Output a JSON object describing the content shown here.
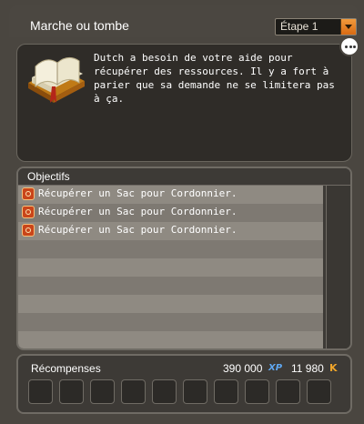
{
  "quest": {
    "title": "Marche ou tombe",
    "step_label": "Étape 1"
  },
  "description": {
    "text": "Dutch a besoin de votre aide pour récupérer des ressources. Il y a fort à parier que sa demande ne se limitera pas à ça."
  },
  "objectives": {
    "header": "Objectifs",
    "items": [
      {
        "label": "Récupérer un Sac pour Cordonnier."
      },
      {
        "label": "Récupérer un Sac pour Cordonnier."
      },
      {
        "label": "Récupérer un Sac pour Cordonnier."
      }
    ],
    "empty_rows": 6
  },
  "rewards": {
    "header": "Récompenses",
    "xp": "390 000",
    "xp_icon": "xp-icon",
    "kamas": "11 980",
    "kamas_icon": "kamas-icon",
    "slot_count": 10
  },
  "colors": {
    "accent": "#e8801f",
    "objective_icon": "#c9451a"
  }
}
